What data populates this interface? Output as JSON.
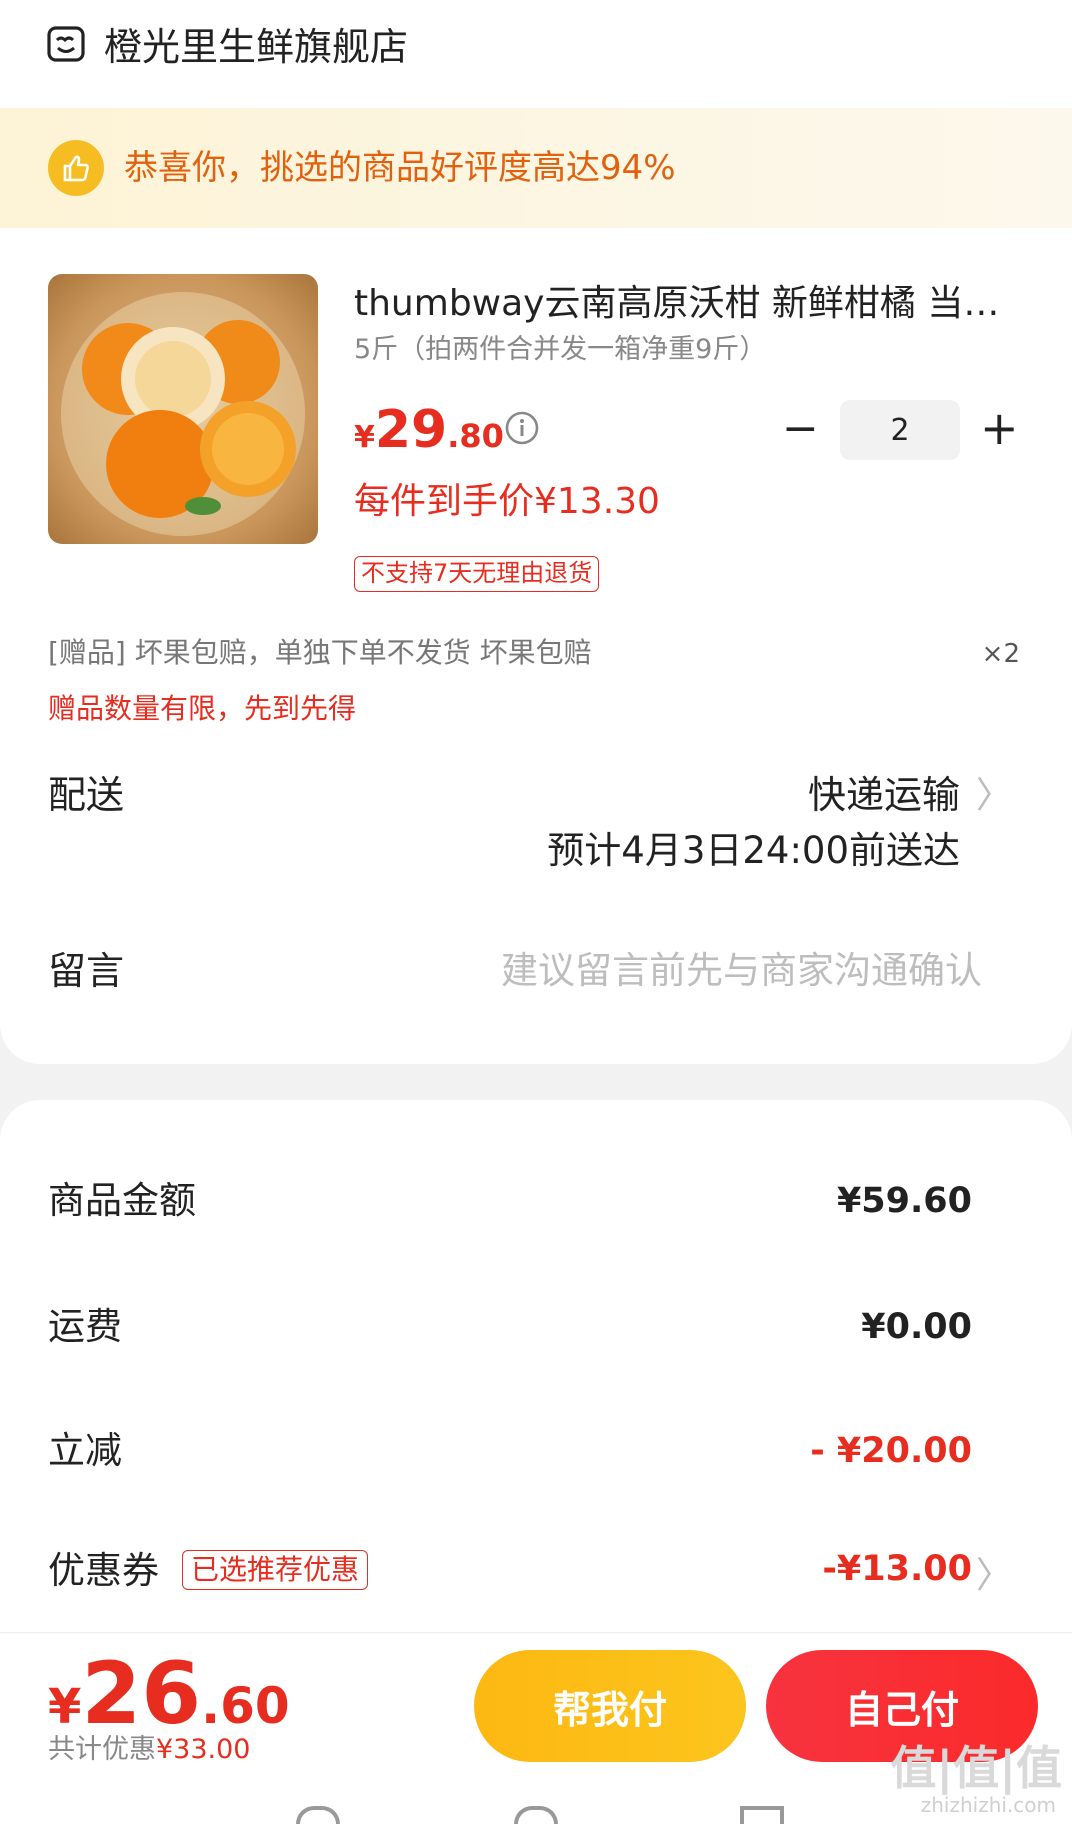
{
  "store": {
    "name": "橙光里生鲜旗舰店",
    "icon": "store-icon"
  },
  "banner": {
    "text": "恭喜你，挑选的商品好评度高达94%",
    "icon": "thumbs-up-icon"
  },
  "product": {
    "title": "thumbway云南高原沃柑 新鲜柑橘 当季水果",
    "spec": "5斤（拍两件合并发一箱净重9斤）",
    "price_symbol": "¥",
    "price_int": "29",
    "price_dec": ".80",
    "quantity": "2",
    "minus_label": "−",
    "plus_label": "+",
    "each_price": "每件到手价¥13.30",
    "no_return_tag": "不支持7天无理由退货"
  },
  "gift": {
    "text": "[赠品]  坏果包赔，单独下单不发货 坏果包赔",
    "count": "×2",
    "note": "赠品数量有限，先到先得"
  },
  "shipping": {
    "label": "配送",
    "method": "快递运输",
    "eta": "预计4月3日24:00前送达",
    "arrow": "〉"
  },
  "message": {
    "label": "留言",
    "placeholder": "建议留言前先与商家沟通确认"
  },
  "summary": {
    "goods_label": "商品金额",
    "goods_value": "¥59.60",
    "freight_label": "运费",
    "freight_value": "¥0.00",
    "discount_label": "立减",
    "discount_value": "- ¥20.00",
    "coupon_label": "优惠券",
    "coupon_tag": "已选推荐优惠",
    "coupon_value": "-¥13.00",
    "coupon_arrow": "〉"
  },
  "footer": {
    "total_symbol": "¥",
    "total_int": "26",
    "total_dec": ".60",
    "save_prefix": "共计优惠",
    "save_value": "¥33.00",
    "help_pay_label": "帮我付",
    "self_pay_label": "自己付"
  },
  "watermark": {
    "main": "值|值|值",
    "sub": "zhizhizhi.com"
  },
  "colors": {
    "accent_red": "#e62d1f",
    "banner_orange": "#e0620e",
    "help_yellow": "#fdb812"
  }
}
